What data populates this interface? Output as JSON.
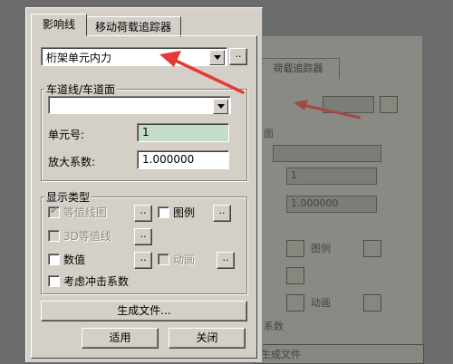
{
  "tabs": [
    {
      "label": "影响线",
      "active": true
    },
    {
      "label": "移动荷载追踪器",
      "active": false
    }
  ],
  "element_type_select": {
    "value": "桁架单元内力"
  },
  "lane_group": {
    "title": "车道线/车道面",
    "lane_select_value": "",
    "element_no_label": "单元号:",
    "element_no_value": "1",
    "scale_label": "放大系数:",
    "scale_value": "1.000000"
  },
  "display_group": {
    "title": "显示类型",
    "contour": {
      "label": "等值线图",
      "checked": true,
      "enabled": false
    },
    "legend": {
      "label": "图例",
      "checked": false,
      "enabled": true
    },
    "contour3d": {
      "label": "3D等值线",
      "checked": false,
      "enabled": false
    },
    "values": {
      "label": "数值",
      "checked": false,
      "enabled": true
    },
    "animation": {
      "label": "动画",
      "checked": false,
      "enabled": false
    },
    "impact": {
      "label": "考虑冲击系数",
      "checked": false,
      "enabled": true
    }
  },
  "buttons": {
    "generate": "生成文件...",
    "apply": "适用",
    "close": "关闭",
    "ellipsis": ".."
  },
  "background_dialog": {
    "tab_label": "荷载追踪器",
    "field_value": "1",
    "scale_value": "1.000000",
    "legend_label": "图例",
    "anim_label": "动画",
    "impact_label": "系数",
    "generate_label": "生成文件",
    "group_label": "面"
  },
  "colors": {
    "dialog_bg": "#d4d0c8",
    "highlight_field": "#c5dcc8",
    "annotation_arrow": "#e53935"
  }
}
